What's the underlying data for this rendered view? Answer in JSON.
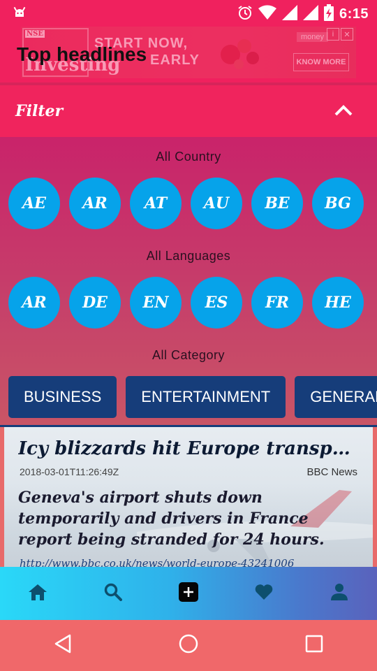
{
  "status_bar": {
    "time": "6:15",
    "icons": [
      "android-debug-icon",
      "alarm-icon",
      "wifi-icon",
      "signal-icon",
      "signal-icon",
      "battery-charging-icon"
    ]
  },
  "header": {
    "title": "Top headlines"
  },
  "ad": {
    "logo_text": "Investing",
    "logo_tag": "NSE",
    "headline_line1": "START NOW,",
    "headline_line2": "EARLY",
    "brand": "money",
    "cta": "KNOW MORE"
  },
  "filter": {
    "title": "Filter",
    "country_label": "All Country",
    "countries": [
      "AE",
      "AR",
      "AT",
      "AU",
      "BE",
      "BG"
    ],
    "language_label": "All Languages",
    "languages": [
      "AR",
      "DE",
      "EN",
      "ES",
      "FR",
      "HE"
    ],
    "category_label": "All Category",
    "categories": [
      "BUSINESS",
      "ENTERTAINMENT",
      "GENERAL"
    ]
  },
  "article": {
    "title": "Icy blizzards hit Europe transport sy…",
    "date": "2018-03-01T11:26:49Z",
    "source": "BBC News",
    "description": "Geneva's airport shuts down temporarily and drivers in France report being stranded for 24 hours.",
    "url": "http://www.bbc.co.uk/news/world-europe-43241006"
  },
  "bottom_nav": {
    "items": [
      "home-icon",
      "search-icon",
      "add-icon",
      "favorite-icon",
      "profile-icon"
    ],
    "active_color": "#0d4f6e"
  },
  "colors": {
    "primary": "#f0245d",
    "chip": "#06a3ea",
    "category_button": "#163d7a"
  }
}
